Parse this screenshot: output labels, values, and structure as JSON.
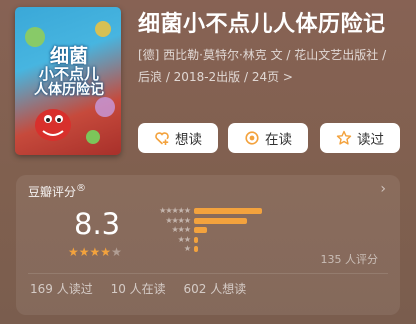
{
  "book": {
    "title": "细菌小不点儿人体历险记",
    "meta": "[德] 西比勒·莫特尔·林克 文 / 花山文艺出版社 / 后浪 / 2018-2出版 / 24页 >",
    "cover": {
      "title_line1": "细菌",
      "title_line2": "小不点儿",
      "title_line3": "人体历险记"
    }
  },
  "actions": {
    "want": "想读",
    "reading": "在读",
    "read": "读过"
  },
  "rating": {
    "label": "豆瓣评分",
    "score": "8.3",
    "stars_filled": 4,
    "stars_total": 5,
    "breakdown_levels": [
      "★★★★★",
      "★★★★",
      "★★★",
      "★★",
      "★"
    ],
    "breakdown": [
      0.37,
      0.29,
      0.07,
      0.02,
      0.02
    ],
    "count": "135 人评分",
    "chevron": "›"
  },
  "stats": {
    "read": "169 人读过",
    "reading": "10 人在读",
    "want": "602 人想读"
  },
  "colors": {
    "accent": "#f3a23d",
    "background": "#876254"
  },
  "icons": [
    "heart-plus-icon",
    "ring-icon",
    "star-outline-icon",
    "chevron-right-icon",
    "registered-icon"
  ]
}
